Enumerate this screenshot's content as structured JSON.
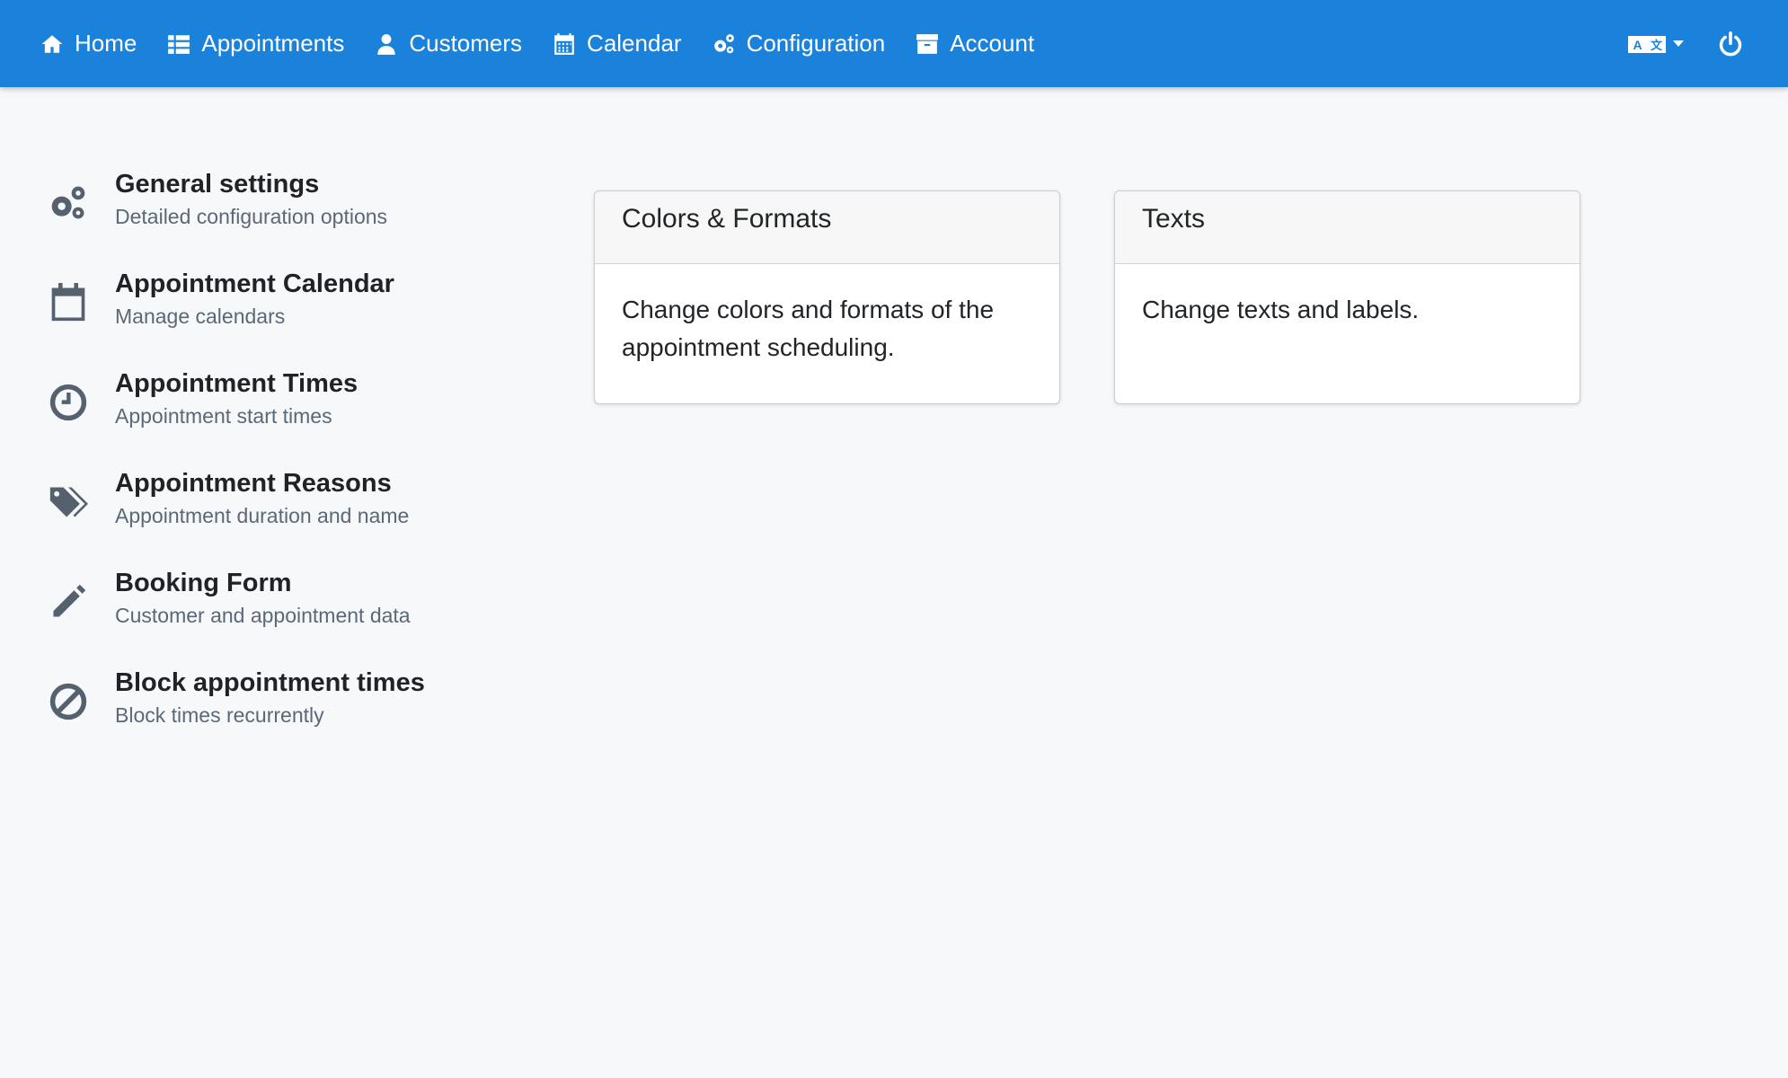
{
  "nav": {
    "items": [
      {
        "label": "Home",
        "icon": "home-icon"
      },
      {
        "label": "Appointments",
        "icon": "list-icon"
      },
      {
        "label": "Customers",
        "icon": "user-icon"
      },
      {
        "label": "Calendar",
        "icon": "calendar-icon"
      },
      {
        "label": "Configuration",
        "icon": "gears-icon"
      },
      {
        "label": "Account",
        "icon": "archive-icon"
      }
    ],
    "language_icon": "language-icon",
    "power_icon": "power-icon"
  },
  "sidebar": {
    "items": [
      {
        "title": "General settings",
        "subtitle": "Detailed configuration options",
        "icon": "gears-icon"
      },
      {
        "title": "Appointment Calendar",
        "subtitle": "Manage calendars",
        "icon": "calendar-icon"
      },
      {
        "title": "Appointment Times",
        "subtitle": "Appointment start times",
        "icon": "clock-icon"
      },
      {
        "title": "Appointment Reasons",
        "subtitle": "Appointment duration and name",
        "icon": "tags-icon"
      },
      {
        "title": "Booking Form",
        "subtitle": "Customer and appointment data",
        "icon": "pencil-icon"
      },
      {
        "title": "Block appointment times",
        "subtitle": "Block times recurrently",
        "icon": "ban-icon"
      }
    ]
  },
  "cards": [
    {
      "title": "Colors & Formats",
      "body": "Change colors and formats of the appointment scheduling."
    },
    {
      "title": "Texts",
      "body": "Change texts and labels."
    }
  ],
  "colors": {
    "navbar": "#1b82dc",
    "background": "#f7f8fa",
    "icon": "#56616f"
  }
}
